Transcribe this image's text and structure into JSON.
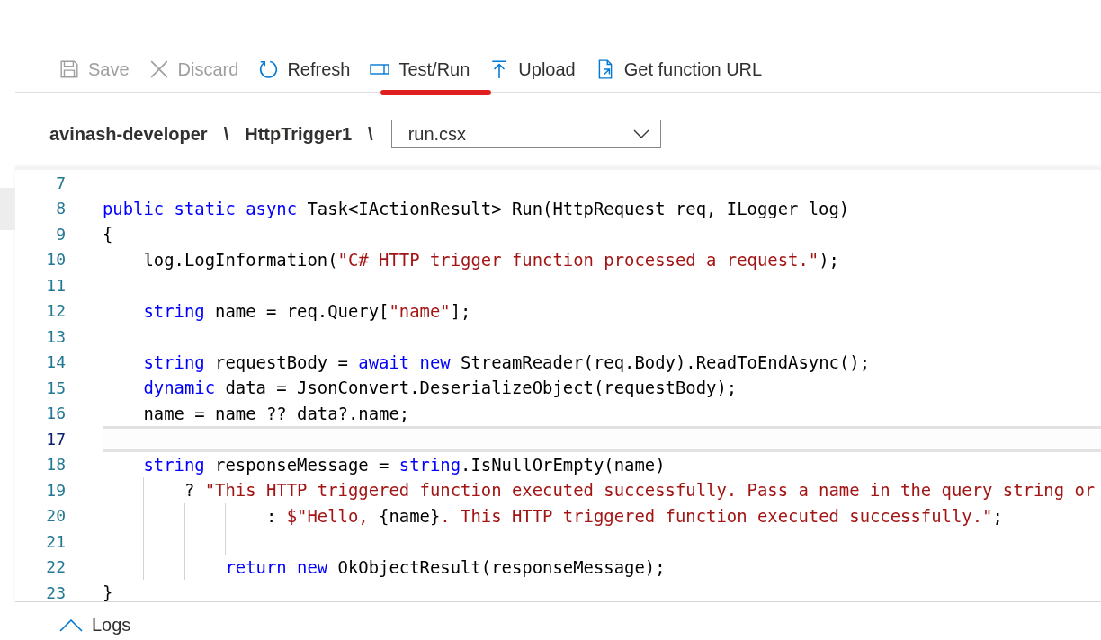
{
  "toolbar": [
    {
      "kind": "save",
      "label": "Save",
      "disabled": true,
      "highlighted": false
    },
    {
      "kind": "discard",
      "label": "Discard",
      "disabled": true,
      "highlighted": false
    },
    {
      "kind": "refresh",
      "label": "Refresh",
      "disabled": false,
      "highlighted": false
    },
    {
      "kind": "test",
      "label": "Test/Run",
      "disabled": false,
      "highlighted": true
    },
    {
      "kind": "upload",
      "label": "Upload",
      "disabled": false,
      "highlighted": false
    },
    {
      "kind": "url",
      "label": "Get function URL",
      "disabled": false,
      "highlighted": false
    }
  ],
  "breadcrumb": {
    "items": [
      "avinash-developer",
      "HttpTrigger1"
    ],
    "separator": "\\",
    "file_select": {
      "value": "run.csx"
    }
  },
  "editor": {
    "lines": [
      {
        "number": "7",
        "current": false
      },
      {
        "number": "8",
        "current": false,
        "tokens": [
          {
            "kind": "kw",
            "text": "public static async"
          },
          {
            "kind": "plain",
            "text": " Task<IActionResult> Run(HttpRequest req, ILogger log)"
          }
        ]
      },
      {
        "number": "9",
        "current": false,
        "tokens": [
          {
            "kind": "plain",
            "text": "{"
          }
        ]
      },
      {
        "number": "10",
        "current": false,
        "tokens": [
          {
            "kind": "plain",
            "text": "    log.LogInformation("
          },
          {
            "kind": "str",
            "text": "\"C# HTTP trigger function processed a request.\""
          },
          {
            "kind": "plain",
            "text": ");"
          }
        ]
      },
      {
        "number": "11",
        "current": false
      },
      {
        "number": "12",
        "current": false,
        "tokens": [
          {
            "kind": "kw",
            "text": "    string"
          },
          {
            "kind": "plain",
            "text": " name = req.Query["
          },
          {
            "kind": "str",
            "text": "\"name\""
          },
          {
            "kind": "plain",
            "text": "];"
          }
        ]
      },
      {
        "number": "13",
        "current": false
      },
      {
        "number": "14",
        "current": false,
        "tokens": [
          {
            "kind": "kw",
            "text": "    string"
          },
          {
            "kind": "plain",
            "text": " requestBody = "
          },
          {
            "kind": "kw",
            "text": "await new"
          },
          {
            "kind": "plain",
            "text": " StreamReader(req.Body).ReadToEndAsync();"
          }
        ]
      },
      {
        "number": "15",
        "current": false,
        "tokens": [
          {
            "kind": "kw",
            "text": "    dynamic"
          },
          {
            "kind": "plain",
            "text": " data = JsonConvert.DeserializeObject(requestBody);"
          }
        ]
      },
      {
        "number": "16",
        "current": false,
        "tokens": [
          {
            "kind": "plain",
            "text": "    name = name ?? data?.name;"
          }
        ]
      },
      {
        "number": "17",
        "current": true
      },
      {
        "number": "18",
        "current": false,
        "tokens": [
          {
            "kind": "kw",
            "text": "    string"
          },
          {
            "kind": "plain",
            "text": " responseMessage = "
          },
          {
            "kind": "kw",
            "text": "string"
          },
          {
            "kind": "plain",
            "text": ".IsNullOrEmpty(name)"
          }
        ]
      },
      {
        "number": "19",
        "current": false,
        "tokens": [
          {
            "kind": "plain",
            "text": "        ? "
          },
          {
            "kind": "str",
            "text": "\"This HTTP triggered function executed successfully. Pass a name in the query string or"
          }
        ]
      },
      {
        "number": "20",
        "current": false,
        "tokens": [
          {
            "kind": "plain",
            "text": "                : "
          },
          {
            "kind": "str",
            "text": "$\"Hello, "
          },
          {
            "kind": "plain",
            "text": "{name}"
          },
          {
            "kind": "str",
            "text": ". This HTTP triggered function executed successfully.\""
          },
          {
            "kind": "plain",
            "text": ";"
          }
        ]
      },
      {
        "number": "21",
        "current": false
      },
      {
        "number": "22",
        "current": false,
        "tokens": [
          {
            "kind": "kw",
            "text": "            return new"
          },
          {
            "kind": "plain",
            "text": " OkObjectResult(responseMessage);"
          }
        ]
      },
      {
        "number": "23",
        "current": false,
        "tokens": [
          {
            "kind": "plain",
            "text": "}"
          }
        ]
      }
    ]
  },
  "logs": {
    "label": "Logs",
    "expanded": false
  }
}
